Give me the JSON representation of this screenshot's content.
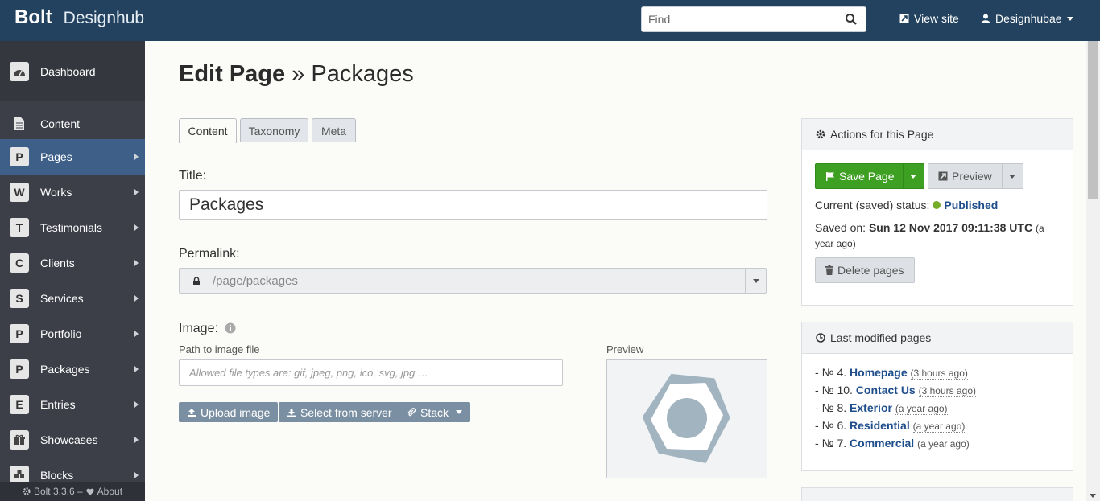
{
  "topbar": {
    "brand": "Bolt",
    "site_name": "Designhub",
    "search_placeholder": "Find",
    "view_site": "View site",
    "user": "Designhubae"
  },
  "sidebar": {
    "dashboard": "Dashboard",
    "content": "Content",
    "items": [
      {
        "badge": "P",
        "label": "Pages"
      },
      {
        "badge": "W",
        "label": "Works"
      },
      {
        "badge": "T",
        "label": "Testimonials"
      },
      {
        "badge": "C",
        "label": "Clients"
      },
      {
        "badge": "S",
        "label": "Services"
      },
      {
        "badge": "P",
        "label": "Portfolio"
      },
      {
        "badge": "P",
        "label": "Packages"
      },
      {
        "badge": "E",
        "label": "Entries"
      },
      {
        "badge": "",
        "label": "Showcases"
      },
      {
        "badge": "",
        "label": "Blocks"
      }
    ],
    "footer_version": "Bolt 3.3.6 –",
    "footer_about": "About"
  },
  "page": {
    "title_bold": "Edit Page",
    "title_rest": "» Packages",
    "tabs": [
      "Content",
      "Taxonomy",
      "Meta"
    ],
    "title_label": "Title:",
    "title_value": "Packages",
    "permalink_label": "Permalink:",
    "permalink_value": "/page/packages",
    "image_label": "Image:",
    "image_path_label": "Path to image file",
    "image_placeholder": "Allowed file types are: gif, jpeg, png, ico, svg, jpg …",
    "preview_label": "Preview",
    "upload_btn": "Upload image",
    "select_btn": "Select from server",
    "stack_btn": "Stack"
  },
  "actions": {
    "header": "Actions for this Page",
    "save": "Save Page",
    "preview": "Preview",
    "status_label": "Current (saved) status:",
    "status_value": "Published",
    "saved_label": "Saved on:",
    "saved_value": "Sun 12 Nov 2017 09:11:38 UTC",
    "saved_ago": "(a year ago)",
    "delete": "Delete pages"
  },
  "recent": {
    "header": "Last modified pages",
    "items": [
      {
        "prefix": "- № 4.",
        "title": "Homepage",
        "ago": "(3 hours ago)"
      },
      {
        "prefix": "- № 10.",
        "title": "Contact Us",
        "ago": "(3 hours ago)"
      },
      {
        "prefix": "- № 8.",
        "title": "Exterior",
        "ago": "(a year ago)"
      },
      {
        "prefix": "- № 6.",
        "title": "Residential",
        "ago": "(a year ago)"
      },
      {
        "prefix": "- № 7.",
        "title": "Commercial",
        "ago": "(a year ago)"
      }
    ]
  },
  "colors": {
    "topbar": "#22425f",
    "sidebar": "#3c3e48",
    "sidebar_active": "#3e6088",
    "save_green": "#3ea022",
    "published_dot": "#75ad28"
  }
}
